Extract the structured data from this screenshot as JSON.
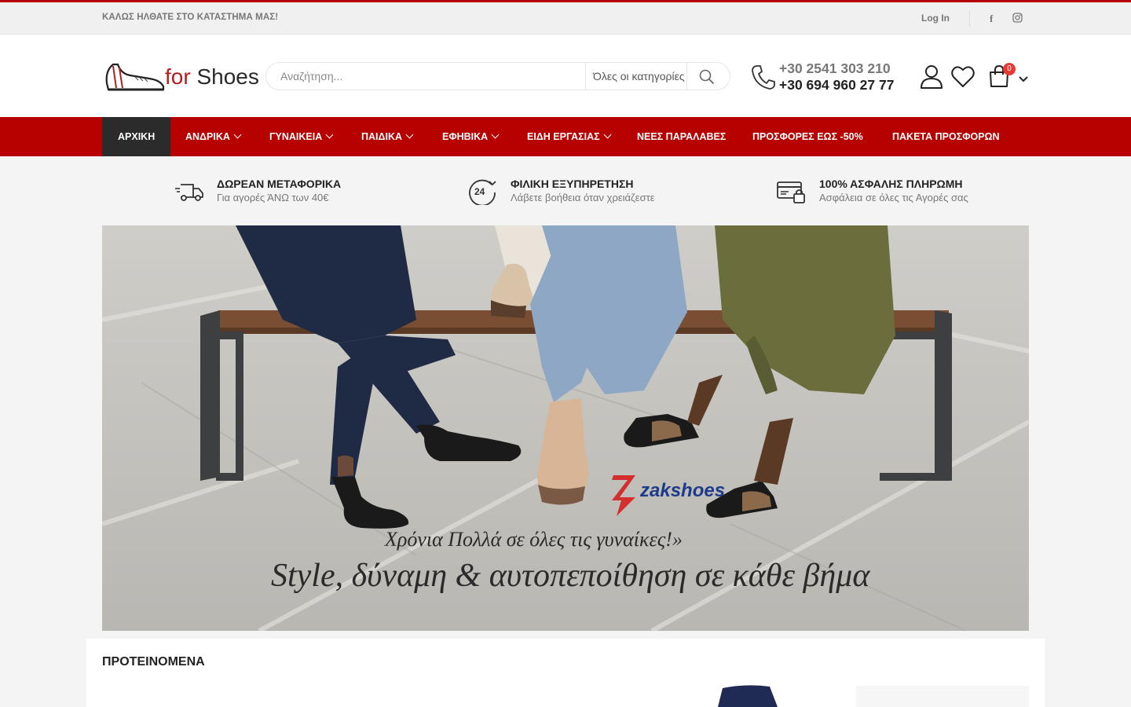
{
  "topbar": {
    "welcome": "ΚΑΛΩΣ ΗΛΘΑΤΕ ΣΤΟ ΚΑΤΑΣΤΗΜΑ ΜΑΣ!",
    "login": "Log In",
    "social": [
      {
        "name": "facebook-icon",
        "glyph": "f"
      },
      {
        "name": "instagram-icon",
        "glyph": "◎"
      }
    ]
  },
  "header": {
    "logo": {
      "for": "for",
      "shoes": "Shoes"
    },
    "search": {
      "placeholder": "Αναζήτηση...",
      "category": "Όλες οι κατηγορίες"
    },
    "phones": [
      "+30 2541 303 210",
      "+30 694 960 27 77"
    ],
    "cart_count": "0"
  },
  "nav": {
    "items": [
      {
        "label": "ΑΡΧΙΚΗ",
        "dropdown": false,
        "active": true
      },
      {
        "label": "ΑΝΔΡΙΚΑ",
        "dropdown": true
      },
      {
        "label": "ΓΥΝΑΙΚΕΙΑ",
        "dropdown": true
      },
      {
        "label": "ΠΑΙΔΙΚΑ",
        "dropdown": true
      },
      {
        "label": "ΕΦΗΒΙΚΑ",
        "dropdown": true
      },
      {
        "label": "ΕΙΔΗ ΕΡΓΑΣΙΑΣ",
        "dropdown": true
      },
      {
        "label": "ΝΕΕΣ ΠΑΡΑΛΑΒΕΣ",
        "dropdown": false
      },
      {
        "label": "ΠΡΟΣΦΟΡΕΣ ΕΩΣ -50%",
        "dropdown": false
      },
      {
        "label": "ΠΑΚΕΤΑ ΠΡΟΣΦΟΡΩΝ",
        "dropdown": false
      }
    ]
  },
  "features": [
    {
      "icon": "truck-icon",
      "title": "ΔΩΡΕΑΝ ΜΕΤΑΦΟΡΙΚΑ",
      "subtitle": "Για αγορές ΆΝΩ των 40€"
    },
    {
      "icon": "support-24-icon",
      "title": "ΦΙΛΙΚΗ ΕΞΥΠΗΡΕΤΗΣΗ",
      "subtitle": "Λάβετε βοήθεια όταν χρειάζεστε"
    },
    {
      "icon": "secure-payment-icon",
      "title": "100% ΑΣΦΑΛΗΣ ΠΛΗΡΩΜΗ",
      "subtitle": "Ασφάλεια σε όλες τις Αγορές σας"
    }
  ],
  "banner": {
    "brand": "zakshoes",
    "line1": "Χρόνια Πολλά σε όλες τις γυναίκες!»",
    "line2": "Style, δύναμη & αυτοπεποίθηση σε κάθε βήμα"
  },
  "products": {
    "title": "ΠΡΟΤΕΙΝΟΜΕΝΑ"
  },
  "colors": {
    "brand_red": "#b70000",
    "active_nav": "#2b2b2b",
    "badge": "#e53935"
  }
}
